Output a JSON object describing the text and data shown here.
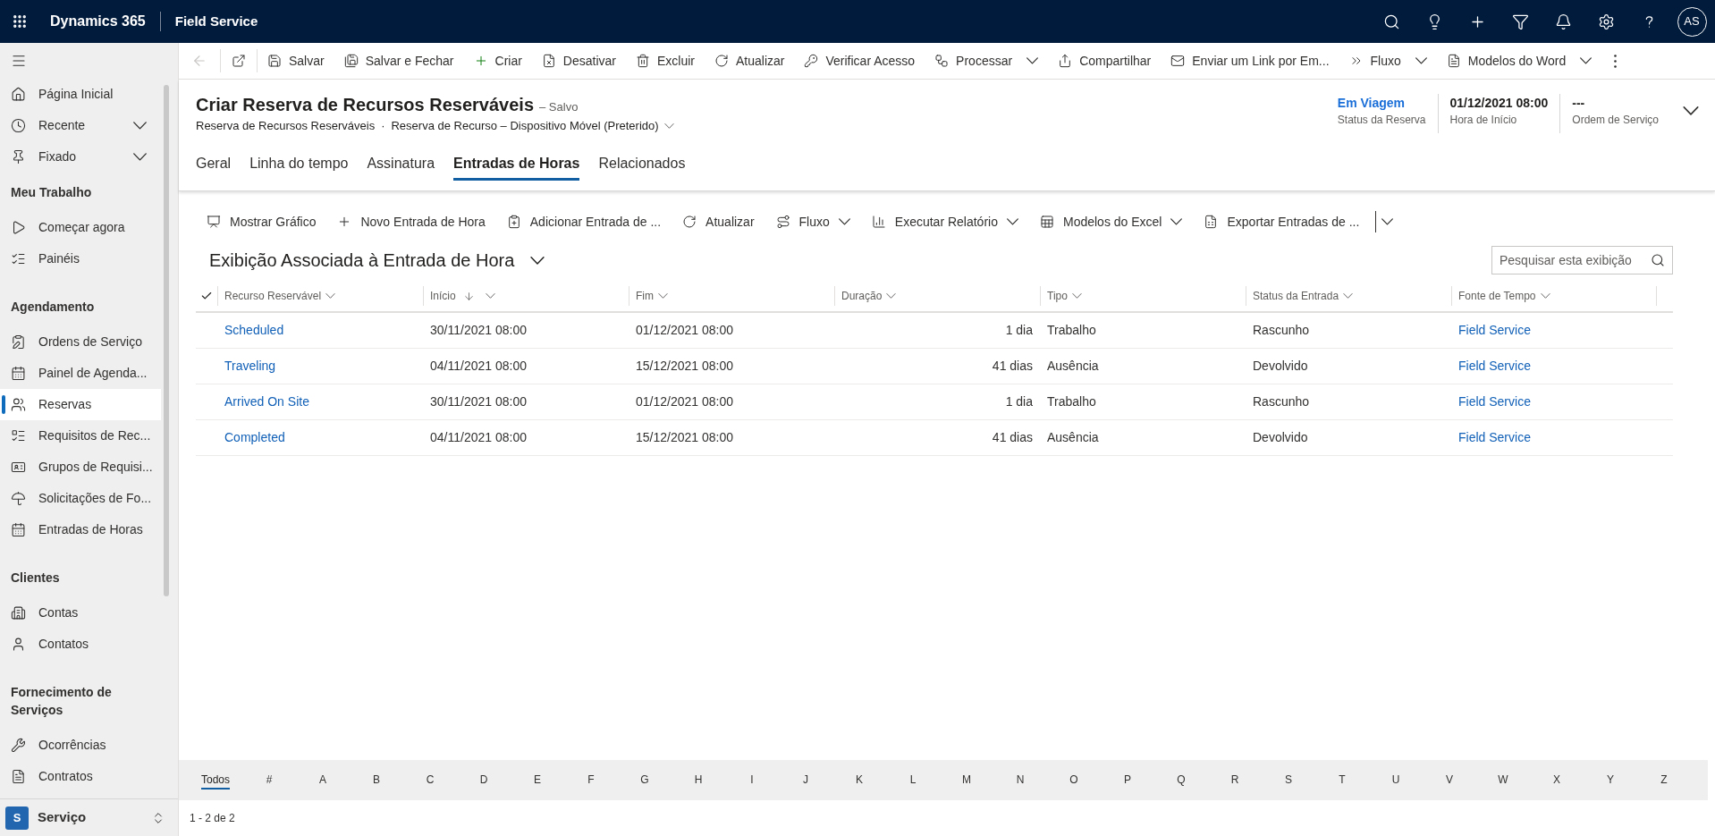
{
  "top_bar": {
    "app_name": "Dynamics 365",
    "area_name": "Field Service",
    "avatar_initials": "AS"
  },
  "sidebar": {
    "top_items": [
      {
        "label": "Página Inicial",
        "expandable": false,
        "selected": false
      },
      {
        "label": "Recente",
        "expandable": true,
        "selected": false
      },
      {
        "label": "Fixado",
        "expandable": true,
        "selected": false
      }
    ],
    "sections": [
      {
        "title": "Meu Trabalho",
        "items": [
          {
            "label": "Começar agora",
            "selected": false
          },
          {
            "label": "Painéis",
            "selected": false
          }
        ]
      },
      {
        "title": "Agendamento",
        "items": [
          {
            "label": "Ordens de Serviço",
            "selected": false
          },
          {
            "label": "Painel de Agenda...",
            "selected": false
          },
          {
            "label": "Reservas",
            "selected": true
          },
          {
            "label": "Requisitos de Rec...",
            "selected": false
          },
          {
            "label": "Grupos de Requisi...",
            "selected": false
          },
          {
            "label": "Solicitações de Fo...",
            "selected": false
          },
          {
            "label": "Entradas de Horas",
            "selected": false
          }
        ]
      },
      {
        "title": "Clientes",
        "items": [
          {
            "label": "Contas",
            "selected": false
          },
          {
            "label": "Contatos",
            "selected": false
          }
        ]
      },
      {
        "title": "Fornecimento de Serviços",
        "items": [
          {
            "label": "Ocorrências",
            "selected": false
          },
          {
            "label": "Contratos",
            "selected": false
          }
        ]
      }
    ],
    "area_switcher": {
      "badge": "S",
      "label": "Serviço"
    }
  },
  "command_bar": {
    "back_button": {
      "disabled": true
    },
    "items": [
      {
        "label": "Salvar",
        "dropdown": false
      },
      {
        "label": "Salvar e Fechar",
        "dropdown": false
      },
      {
        "label": "Criar",
        "dropdown": false
      },
      {
        "label": "Desativar",
        "dropdown": false
      },
      {
        "label": "Excluir",
        "dropdown": false
      },
      {
        "label": "Atualizar",
        "dropdown": false
      },
      {
        "label": "Verificar Acesso",
        "dropdown": false
      },
      {
        "label": "Processar",
        "dropdown": true
      },
      {
        "label": "Compartilhar",
        "dropdown": false
      },
      {
        "label": "Enviar um Link por Em...",
        "dropdown": false
      },
      {
        "label": "Fluxo",
        "dropdown": true
      },
      {
        "label": "Modelos do Word",
        "dropdown": true
      }
    ]
  },
  "record": {
    "title": "Criar Reserva de Recursos Reserváveis",
    "save_status": "– Salvo",
    "entity": "Reserva de Recursos Reserváveis",
    "separator": "·",
    "form": "Reserva de Recurso – Dispositivo Móvel (Preterido)"
  },
  "header_fields": [
    {
      "kind": "link",
      "value": "Em Viagem",
      "label": "Status da Reserva"
    },
    {
      "kind": "text",
      "value": "01/12/2021 08:00",
      "label": "Hora de Início"
    },
    {
      "kind": "text",
      "value": "---",
      "label": "Ordem de Serviço"
    }
  ],
  "tabs": [
    {
      "label": "Geral",
      "selected": false
    },
    {
      "label": "Linha do tempo",
      "selected": false
    },
    {
      "label": "Assinatura",
      "selected": false
    },
    {
      "label": "Entradas de Horas",
      "selected": true
    },
    {
      "label": "Relacionados",
      "selected": false
    }
  ],
  "subgrid": {
    "commands": [
      {
        "label": "Mostrar Gráfico",
        "dropdown": false
      },
      {
        "label": "Novo Entrada de Hora",
        "dropdown": false
      },
      {
        "label": "Adicionar Entrada de ...",
        "dropdown": false
      },
      {
        "label": "Atualizar",
        "dropdown": false
      },
      {
        "label": "Fluxo",
        "dropdown": true
      },
      {
        "label": "Executar Relatório",
        "dropdown": true
      },
      {
        "label": "Modelos do Excel",
        "dropdown": true
      },
      {
        "label": "Exportar Entradas de ...",
        "dropdown": false
      }
    ],
    "view_title": "Exibição Associada à Entrada de Hora",
    "search": {
      "placeholder": "Pesquisar esta exibição"
    },
    "columns": [
      {
        "label": "Recurso Reservável",
        "sorted_descending": false,
        "kind": "link"
      },
      {
        "label": "Início",
        "sorted_descending": true,
        "kind": "text"
      },
      {
        "label": "Fim",
        "sorted_descending": false,
        "kind": "text"
      },
      {
        "label": "Duração",
        "sorted_descending": false,
        "kind": "number"
      },
      {
        "label": "Tipo",
        "sorted_descending": false,
        "kind": "text"
      },
      {
        "label": "Status da Entrada",
        "sorted_descending": false,
        "kind": "text"
      },
      {
        "label": "Fonte de Tempo",
        "sorted_descending": false,
        "kind": "link"
      }
    ],
    "rows": [
      {
        "cells": [
          "Scheduled",
          "30/11/2021 08:00",
          "01/12/2021 08:00",
          "1 dia",
          "Trabalho",
          "Rascunho",
          "Field Service"
        ]
      },
      {
        "cells": [
          "Traveling",
          "04/11/2021 08:00",
          "15/12/2021 08:00",
          "41 dias",
          "Ausência",
          "Devolvido",
          "Field Service"
        ]
      },
      {
        "cells": [
          "Arrived On Site",
          "30/11/2021 08:00",
          "01/12/2021 08:00",
          "1 dia",
          "Trabalho",
          "Rascunho",
          "Field Service"
        ]
      },
      {
        "cells": [
          "Completed",
          "04/11/2021 08:00",
          "15/12/2021 08:00",
          "41 dias",
          "Ausência",
          "Devolvido",
          "Field Service"
        ]
      }
    ],
    "jump_bar": [
      {
        "label": "Todos",
        "selected": true
      },
      {
        "label": "#",
        "selected": false
      },
      {
        "label": "A",
        "selected": false
      },
      {
        "label": "B",
        "selected": false
      },
      {
        "label": "C",
        "selected": false
      },
      {
        "label": "D",
        "selected": false
      },
      {
        "label": "E",
        "selected": false
      },
      {
        "label": "F",
        "selected": false
      },
      {
        "label": "G",
        "selected": false
      },
      {
        "label": "H",
        "selected": false
      },
      {
        "label": "I",
        "selected": false
      },
      {
        "label": "J",
        "selected": false
      },
      {
        "label": "K",
        "selected": false
      },
      {
        "label": "L",
        "selected": false
      },
      {
        "label": "M",
        "selected": false
      },
      {
        "label": "N",
        "selected": false
      },
      {
        "label": "O",
        "selected": false
      },
      {
        "label": "P",
        "selected": false
      },
      {
        "label": "Q",
        "selected": false
      },
      {
        "label": "R",
        "selected": false
      },
      {
        "label": "S",
        "selected": false
      },
      {
        "label": "T",
        "selected": false
      },
      {
        "label": "U",
        "selected": false
      },
      {
        "label": "V",
        "selected": false
      },
      {
        "label": "W",
        "selected": false
      },
      {
        "label": "X",
        "selected": false
      },
      {
        "label": "Y",
        "selected": false
      },
      {
        "label": "Z",
        "selected": false
      }
    ],
    "record_count": "1 - 2 de 2"
  }
}
